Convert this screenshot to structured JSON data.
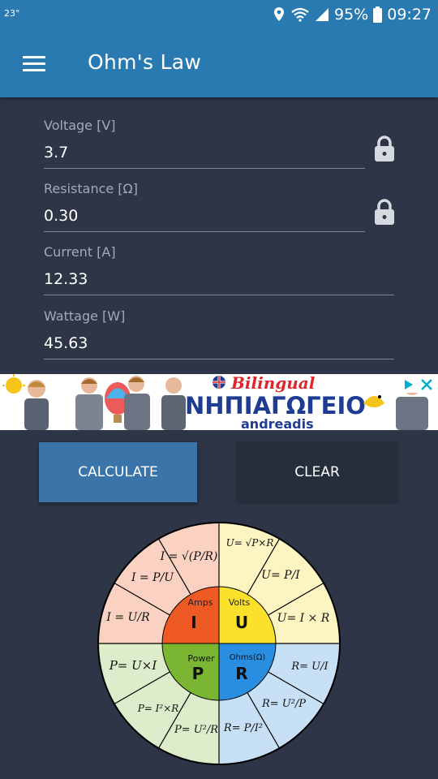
{
  "status_bar": {
    "temperature": "23°",
    "battery": "95%",
    "time": "09:27"
  },
  "app": {
    "title": "Ohm's Law"
  },
  "fields": [
    {
      "label": "Voltage [V]",
      "value": "3.7",
      "locked": true
    },
    {
      "label": "Resistance [Ω]",
      "value": "0.30",
      "locked": true
    },
    {
      "label": "Current [A]",
      "value": "12.33",
      "locked": false
    },
    {
      "label": "Wattage [W]",
      "value": "45.63",
      "locked": false
    }
  ],
  "ad": {
    "line1": "Bilingual",
    "line2": "ΝΗΠΙΑΓΩΓΕΙΟ",
    "line3": "andreadis"
  },
  "buttons": {
    "calculate": "CALCULATE",
    "clear": "CLEAR"
  },
  "wheel": {
    "quadrants": {
      "amps": "Amps",
      "volts": "Volts",
      "power": "Power",
      "ohms": "Ohms(Ω)"
    },
    "symbols": {
      "amps": "I",
      "volts": "U",
      "power": "P",
      "ohms": "R"
    },
    "formulas": {
      "i_sqrt": "I = √(P/R)",
      "i_pu": "I = P/U",
      "i_ur": "I = U/R",
      "u_sqrt": "U= √P×R",
      "u_pi": "U= P/I",
      "u_ir": "U= I × R",
      "p_ui": "P= U×I",
      "p_i2r": "P= I²×R",
      "p_u2r": "P= U²/R",
      "r_ui": "R= U/I",
      "r_u2p": "R= U²/P",
      "r_pi2": "R= P/I²"
    },
    "colors": {
      "amps": "#ef5a24",
      "volts": "#fbe12c",
      "power": "#7ab632",
      "ohms": "#2a8ee0"
    }
  }
}
